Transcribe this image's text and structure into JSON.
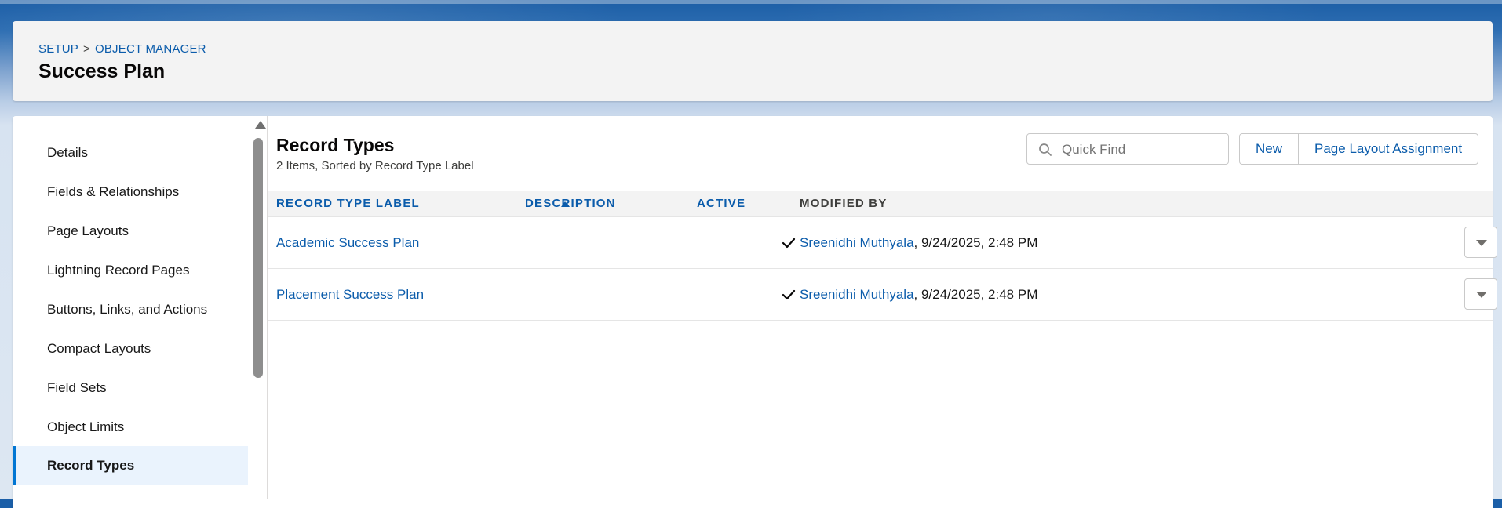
{
  "header": {
    "breadcrumb": {
      "setup": "SETUP",
      "separator": ">",
      "object_manager": "OBJECT MANAGER"
    },
    "title": "Success Plan"
  },
  "sidebar": {
    "items": [
      {
        "label": "Details",
        "active": false
      },
      {
        "label": "Fields & Relationships",
        "active": false
      },
      {
        "label": "Page Layouts",
        "active": false
      },
      {
        "label": "Lightning Record Pages",
        "active": false
      },
      {
        "label": "Buttons, Links, and Actions",
        "active": false
      },
      {
        "label": "Compact Layouts",
        "active": false
      },
      {
        "label": "Field Sets",
        "active": false
      },
      {
        "label": "Object Limits",
        "active": false
      },
      {
        "label": "Record Types",
        "active": true
      }
    ]
  },
  "main": {
    "title": "Record Types",
    "subtitle": "2 Items, Sorted by Record Type Label",
    "search": {
      "placeholder": "Quick Find",
      "value": "",
      "icon": "search-icon"
    },
    "buttons": {
      "new": "New",
      "page_layout_assignment": "Page Layout Assignment"
    },
    "table": {
      "columns": [
        "RECORD TYPE LABEL",
        "DESCRIPTION",
        "ACTIVE",
        "MODIFIED BY"
      ],
      "sorted_column": "RECORD TYPE LABEL",
      "sort_direction": "ascending",
      "rows": [
        {
          "label": "Academic Success Plan",
          "description": "",
          "active": true,
          "modified_by": "Sreenidhi Muthyala",
          "modified_date": ", 9/24/2025, 2:48 PM"
        },
        {
          "label": "Placement Success Plan",
          "description": "",
          "active": true,
          "modified_by": "Sreenidhi Muthyala",
          "modified_date": ", 9/24/2025, 2:48 PM"
        }
      ]
    }
  },
  "colors": {
    "link": "#0b5cab",
    "active_nav_border": "#0176d3",
    "active_nav_bg": "#eaf3fd",
    "banner": "#1c5ea6"
  }
}
